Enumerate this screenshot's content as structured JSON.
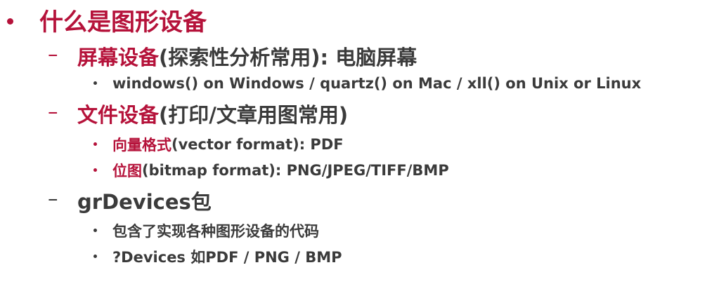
{
  "slide": {
    "title": "什么是图形设备",
    "sections": [
      {
        "heading_red": "屏幕设备",
        "heading_dark": "(探索性分析常用): 电脑屏幕",
        "items": [
          {
            "red": "",
            "dark": "windows() on Windows / quartz() on Mac / xll() on Unix or Linux"
          }
        ]
      },
      {
        "heading_red": "文件设备",
        "heading_dark": "(打印/文章用图常用)",
        "items": [
          {
            "red": "向量格式",
            "dark": " (vector format): PDF"
          },
          {
            "red": "位图",
            "dark": " (bitmap format): PNG/JPEG/TIFF/BMP"
          }
        ]
      },
      {
        "heading_red": "",
        "heading_dark": "grDevices包",
        "items": [
          {
            "red": "",
            "dark": "包含了实现各种图形设备的代码"
          },
          {
            "red": "",
            "dark": "?Devices 如PDF / PNG / BMP"
          }
        ]
      }
    ]
  },
  "colors": {
    "accent": "#b5123a",
    "text": "#3b3b3b",
    "background": "#ffffff"
  }
}
